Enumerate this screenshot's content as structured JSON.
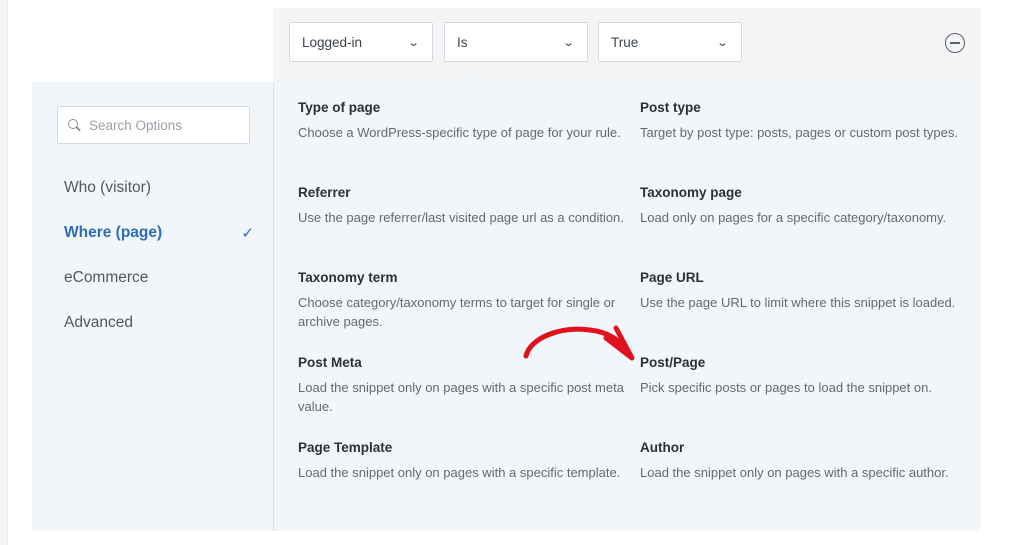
{
  "rule": {
    "condition_select": "Logged-in",
    "operator_select": "Is",
    "value_select": "True"
  },
  "icons": {
    "chevron": "chevron-down-icon",
    "remove": "remove-circle-icon",
    "search": "search-icon",
    "check": "checkmark-icon",
    "annotation": "red-arrow"
  },
  "colors": {
    "accent": "#2c6db5",
    "annotation_arrow": "#e0101d",
    "panel_bg": "#f1f6fb"
  },
  "sidebar": {
    "search_placeholder": "Search Options",
    "items": [
      {
        "label": "Who (visitor)",
        "active": false
      },
      {
        "label": "Where (page)",
        "active": true
      },
      {
        "label": "eCommerce",
        "active": false
      },
      {
        "label": "Advanced",
        "active": false
      }
    ],
    "check_glyph": "✓"
  },
  "options": [
    {
      "title": "Type of page",
      "description": "Choose a WordPress-specific type of page for your rule."
    },
    {
      "title": "Post type",
      "description": "Target by post type: posts, pages or custom post types."
    },
    {
      "title": "Referrer",
      "description": "Use the page referrer/last visited page url as a condition."
    },
    {
      "title": "Taxonomy page",
      "description": "Load only on pages for a specific category/taxonomy."
    },
    {
      "title": "Taxonomy term",
      "description": "Choose category/taxonomy terms to target for single or archive pages."
    },
    {
      "title": "Page URL",
      "description": "Use the page URL to limit where this snippet is loaded."
    },
    {
      "title": "Post Meta",
      "description": "Load the snippet only on pages with a specific post meta value."
    },
    {
      "title": "Post/Page",
      "description": "Pick specific posts or pages to load the snippet on."
    },
    {
      "title": "Page Template",
      "description": "Load the snippet only on pages with a specific template."
    },
    {
      "title": "Author",
      "description": "Load the snippet only on pages with a specific author."
    }
  ]
}
